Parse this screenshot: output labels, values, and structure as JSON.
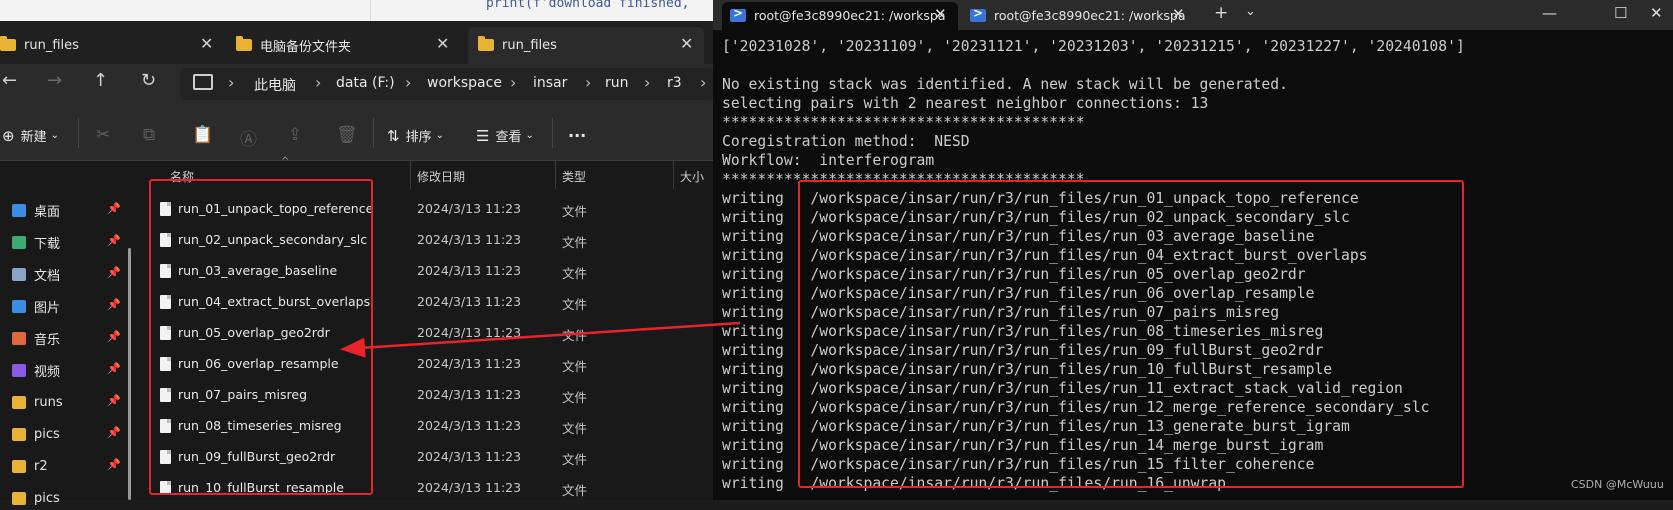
{
  "editor": {
    "code": "print(f'download finished,",
    "code_color": "#3d5a9e"
  },
  "explorer": {
    "tabs": [
      {
        "label": "run_files"
      },
      {
        "label": "电脑备份文件夹"
      },
      {
        "label": "run_files"
      }
    ],
    "breadcrumb": [
      "此电脑",
      "data (F:)",
      "workspace",
      "insar",
      "run",
      "r3"
    ],
    "toolbar": {
      "new_label": "新建",
      "sort_label": "排序",
      "view_label": "查看",
      "more_label": "···"
    },
    "sidebar": [
      {
        "label": "桌面",
        "icon": "desktop-icon",
        "color": "#3a8ee6"
      },
      {
        "label": "下载",
        "icon": "download-icon",
        "color": "#3aae72"
      },
      {
        "label": "文档",
        "icon": "document-icon",
        "color": "#8aa4c6"
      },
      {
        "label": "图片",
        "icon": "picture-icon",
        "color": "#3a8ee6"
      },
      {
        "label": "音乐",
        "icon": "music-icon",
        "color": "#e0683a"
      },
      {
        "label": "视频",
        "icon": "video-icon",
        "color": "#8a5ae6"
      },
      {
        "label": "runs",
        "icon": "folder-icon",
        "color": "#e8b232"
      },
      {
        "label": "pics",
        "icon": "folder-icon",
        "color": "#e8b232"
      },
      {
        "label": "r2",
        "icon": "folder-icon",
        "color": "#e8b232"
      },
      {
        "label": "pics",
        "icon": "folder-icon",
        "color": "#e8b232"
      }
    ],
    "columns": {
      "name": "名称",
      "date": "修改日期",
      "type": "类型",
      "size": "大小"
    },
    "files": [
      {
        "name": "run_01_unpack_topo_reference",
        "date": "2024/3/13 11:23",
        "type": "文件"
      },
      {
        "name": "run_02_unpack_secondary_slc",
        "date": "2024/3/13 11:23",
        "type": "文件"
      },
      {
        "name": "run_03_average_baseline",
        "date": "2024/3/13 11:23",
        "type": "文件"
      },
      {
        "name": "run_04_extract_burst_overlaps",
        "date": "2024/3/13 11:23",
        "type": "文件"
      },
      {
        "name": "run_05_overlap_geo2rdr",
        "date": "2024/3/13 11:23",
        "type": "文件"
      },
      {
        "name": "run_06_overlap_resample",
        "date": "2024/3/13 11:23",
        "type": "文件"
      },
      {
        "name": "run_07_pairs_misreg",
        "date": "2024/3/13 11:23",
        "type": "文件"
      },
      {
        "name": "run_08_timeseries_misreg",
        "date": "2024/3/13 11:23",
        "type": "文件"
      },
      {
        "name": "run_09_fullBurst_geo2rdr",
        "date": "2024/3/13 11:23",
        "type": "文件"
      },
      {
        "name": "run_10_fullBurst_resample",
        "date": "2024/3/13 11:23",
        "type": "文件"
      }
    ]
  },
  "terminal": {
    "tabs": [
      {
        "label": "root@fe3c8990ec21: /workspa"
      },
      {
        "label": "root@fe3c8990ec21: /workspa"
      }
    ],
    "lines": [
      "['20231028', '20231109', '20231121', '20231203', '20231215', '20231227', '20240108']",
      "",
      "No existing stack was identified. A new stack will be generated.",
      "selecting pairs with 2 nearest neighbor connections: 13",
      "*****************************************",
      "Coregistration method:  NESD",
      "Workflow:  interferogram",
      "*****************************************",
      "writing   /workspace/insar/run/r3/run_files/run_01_unpack_topo_reference",
      "writing   /workspace/insar/run/r3/run_files/run_02_unpack_secondary_slc",
      "writing   /workspace/insar/run/r3/run_files/run_03_average_baseline",
      "writing   /workspace/insar/run/r3/run_files/run_04_extract_burst_overlaps",
      "writing   /workspace/insar/run/r3/run_files/run_05_overlap_geo2rdr",
      "writing   /workspace/insar/run/r3/run_files/run_06_overlap_resample",
      "writing   /workspace/insar/run/r3/run_files/run_07_pairs_misreg",
      "writing   /workspace/insar/run/r3/run_files/run_08_timeseries_misreg",
      "writing   /workspace/insar/run/r3/run_files/run_09_fullBurst_geo2rdr",
      "writing   /workspace/insar/run/r3/run_files/run_10_fullBurst_resample",
      "writing   /workspace/insar/run/r3/run_files/run_11_extract_stack_valid_region",
      "writing   /workspace/insar/run/r3/run_files/run_12_merge_reference_secondary_slc",
      "writing   /workspace/insar/run/r3/run_files/run_13_generate_burst_igram",
      "writing   /workspace/insar/run/r3/run_files/run_14_merge_burst_igram",
      "writing   /workspace/insar/run/r3/run_files/run_15_filter_coherence",
      "writing   /workspace/insar/run/r3/run_files/run_16_unwrap"
    ]
  },
  "watermark": "CSDN @McWuuu",
  "annotation_color": "#e8242a"
}
